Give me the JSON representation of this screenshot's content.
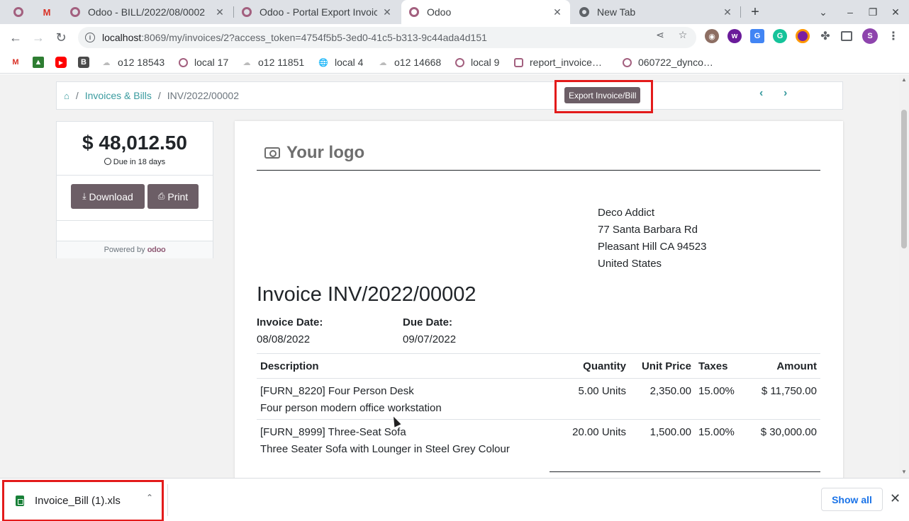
{
  "browser": {
    "tabs": [
      {
        "title": ""
      },
      {
        "title": ""
      },
      {
        "title": "Odoo - BILL/2022/08/0002"
      },
      {
        "title": "Odoo - Portal Export Invoice"
      },
      {
        "title": "Odoo"
      },
      {
        "title": "New Tab"
      }
    ],
    "new_tab": "+",
    "url_host": "localhost",
    "url_path": ":8069/my/invoices/2?access_token=4754f5b5-3ed0-41c5-b313-9c44ada4d151",
    "profile_initial": "S",
    "bookmarks": [
      "o12 18543",
      "local 17",
      "o12 11851",
      "local 4",
      "o12 14668",
      "local 9",
      "report_invoice…",
      "060722_dynco…"
    ]
  },
  "breadcrumb": {
    "section": "Invoices & Bills",
    "current": "INV/2022/00002"
  },
  "export_button": "Export Invoice/Bill",
  "sidebar": {
    "amount": "$ 48,012.50",
    "due": "Due in 18 days",
    "download": "Download",
    "print": "Print",
    "powered_by": "Powered by",
    "brand": "odoo"
  },
  "invoice": {
    "logo_text": "Your logo",
    "address": [
      "Deco Addict",
      "77 Santa Barbara Rd",
      "Pleasant Hill CA 94523",
      "United States"
    ],
    "title": "Invoice INV/2022/00002",
    "invoice_date_label": "Invoice Date:",
    "invoice_date": "08/08/2022",
    "due_date_label": "Due Date:",
    "due_date": "09/07/2022",
    "columns": {
      "description": "Description",
      "quantity": "Quantity",
      "unit_price": "Unit Price",
      "taxes": "Taxes",
      "amount": "Amount"
    },
    "lines": [
      {
        "name": "[FURN_8220] Four Person Desk",
        "desc": "Four person modern office workstation",
        "quantity": "5.00 Units",
        "unit_price": "2,350.00",
        "taxes": "15.00%",
        "amount": "$ 11,750.00"
      },
      {
        "name": "[FURN_8999] Three-Seat Sofa",
        "desc": "Three Seater Sofa with Lounger in Steel Grey Colour",
        "quantity": "20.00 Units",
        "unit_price": "1,500.00",
        "taxes": "15.00%",
        "amount": "$ 30,000.00"
      }
    ]
  },
  "downloads": {
    "file": "Invoice_Bill (1).xls",
    "show_all": "Show all"
  },
  "colors": {
    "accent": "#3a9b9f",
    "button": "#6c5e66",
    "highlight": "#e31b1b"
  }
}
